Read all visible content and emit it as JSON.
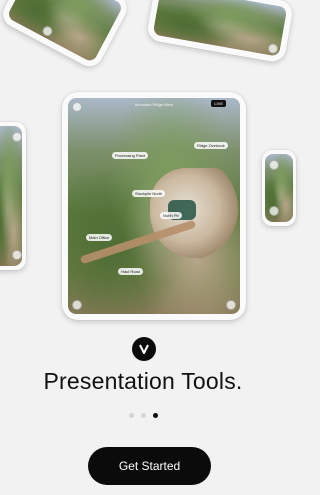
{
  "carousel": {
    "main_card": {
      "title": "Mountain Ridge Mine",
      "badge": "LIVE",
      "tags": [
        "Processing Plant",
        "Ridge Overlook",
        "Stockpile North",
        "Main Office",
        "North Pit",
        "Haul Road"
      ]
    }
  },
  "brand": {
    "logo_letter": "V"
  },
  "headline": "Presentation Tools.",
  "pagination": {
    "pages": 3,
    "active_index": 2
  },
  "cta": {
    "label": "Get Started"
  },
  "colors": {
    "background": "#f2f2f2",
    "accent": "#0b0b0b"
  }
}
